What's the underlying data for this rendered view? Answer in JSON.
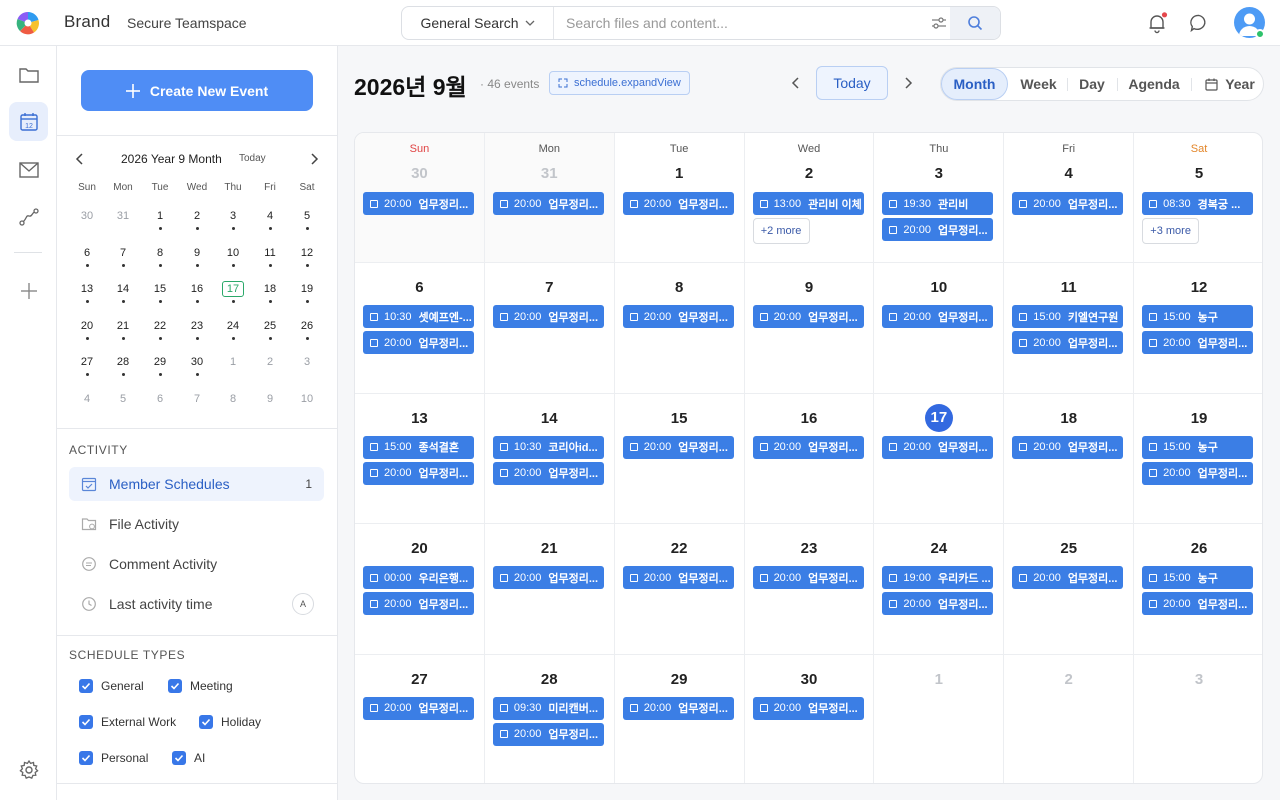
{
  "app": {
    "brand": "Brand",
    "team": "Secure Teamspace"
  },
  "search": {
    "scope": "General Search",
    "placeholder": "Search files and content..."
  },
  "sidebar": {
    "create_label": "Create New Event",
    "mini_cal": {
      "title": "2026 Year 9 Month",
      "today_label": "Today",
      "dow": [
        "Sun",
        "Mon",
        "Tue",
        "Wed",
        "Thu",
        "Fri",
        "Sat"
      ],
      "weeks": [
        [
          "30",
          "31",
          "1",
          "2",
          "3",
          "4",
          "5"
        ],
        [
          "6",
          "7",
          "8",
          "9",
          "10",
          "11",
          "12"
        ],
        [
          "13",
          "14",
          "15",
          "16",
          "17",
          "18",
          "19"
        ],
        [
          "20",
          "21",
          "22",
          "23",
          "24",
          "25",
          "26"
        ],
        [
          "27",
          "28",
          "29",
          "30",
          "1",
          "2",
          "3"
        ],
        [
          "4",
          "5",
          "6",
          "7",
          "8",
          "9",
          "10"
        ]
      ]
    },
    "activity_title": "ACTIVITY",
    "activity": [
      {
        "label": "Member Schedules",
        "count": "1"
      },
      {
        "label": "File Activity"
      },
      {
        "label": "Comment Activity"
      },
      {
        "label": "Last activity time",
        "badge": "A"
      }
    ],
    "types_title": "SCHEDULE TYPES",
    "types": [
      "General",
      "Meeting",
      "External Work",
      "Holiday",
      "Personal",
      "AI"
    ]
  },
  "header": {
    "title": "2026년 9월",
    "event_count": "46 events",
    "expand_label": "schedule.expandView",
    "today_label": "Today",
    "views": [
      "Month",
      "Week",
      "Day",
      "Agenda",
      "Year"
    ],
    "active_view": "Month"
  },
  "calendar": {
    "dow": [
      "Sun",
      "Mon",
      "Tue",
      "Wed",
      "Thu",
      "Fri",
      "Sat"
    ],
    "today": "17",
    "weeks": [
      [
        {
          "day": "30",
          "other": true,
          "events": [
            [
              "20:00",
              "업무정리..."
            ]
          ]
        },
        {
          "day": "31",
          "other": true,
          "events": [
            [
              "20:00",
              "업무정리..."
            ]
          ]
        },
        {
          "day": "1",
          "events": [
            [
              "20:00",
              "업무정리..."
            ]
          ]
        },
        {
          "day": "2",
          "events": [
            [
              "13:00",
              "관리비 이체"
            ]
          ],
          "more": "+2 more"
        },
        {
          "day": "3",
          "events": [
            [
              "19:30",
              "관리비"
            ],
            [
              "20:00",
              "업무정리..."
            ]
          ]
        },
        {
          "day": "4",
          "events": [
            [
              "20:00",
              "업무정리..."
            ]
          ]
        },
        {
          "day": "5",
          "events": [
            [
              "08:30",
              "경복궁 ..."
            ]
          ],
          "more": "+3 more"
        }
      ],
      [
        {
          "day": "6",
          "events": [
            [
              "10:30",
              "셋예프엔-..."
            ],
            [
              "20:00",
              "업무정리..."
            ]
          ]
        },
        {
          "day": "7",
          "events": [
            [
              "20:00",
              "업무정리..."
            ]
          ]
        },
        {
          "day": "8",
          "events": [
            [
              "20:00",
              "업무정리..."
            ]
          ]
        },
        {
          "day": "9",
          "events": [
            [
              "20:00",
              "업무정리..."
            ]
          ]
        },
        {
          "day": "10",
          "events": [
            [
              "20:00",
              "업무정리..."
            ]
          ]
        },
        {
          "day": "11",
          "events": [
            [
              "15:00",
              "키엘연구원"
            ],
            [
              "20:00",
              "업무정리..."
            ]
          ]
        },
        {
          "day": "12",
          "events": [
            [
              "15:00",
              "농구"
            ],
            [
              "20:00",
              "업무정리..."
            ]
          ]
        }
      ],
      [
        {
          "day": "13",
          "events": [
            [
              "15:00",
              "종석결혼"
            ],
            [
              "20:00",
              "업무정리..."
            ]
          ]
        },
        {
          "day": "14",
          "events": [
            [
              "10:30",
              "코리아id..."
            ],
            [
              "20:00",
              "업무정리..."
            ]
          ]
        },
        {
          "day": "15",
          "events": [
            [
              "20:00",
              "업무정리..."
            ]
          ]
        },
        {
          "day": "16",
          "events": [
            [
              "20:00",
              "업무정리..."
            ]
          ]
        },
        {
          "day": "17",
          "events": [
            [
              "20:00",
              "업무정리..."
            ]
          ]
        },
        {
          "day": "18",
          "events": [
            [
              "20:00",
              "업무정리..."
            ]
          ]
        },
        {
          "day": "19",
          "events": [
            [
              "15:00",
              "농구"
            ],
            [
              "20:00",
              "업무정리..."
            ]
          ]
        }
      ],
      [
        {
          "day": "20",
          "events": [
            [
              "00:00",
              "우리은행..."
            ],
            [
              "20:00",
              "업무정리..."
            ]
          ]
        },
        {
          "day": "21",
          "events": [
            [
              "20:00",
              "업무정리..."
            ]
          ]
        },
        {
          "day": "22",
          "events": [
            [
              "20:00",
              "업무정리..."
            ]
          ]
        },
        {
          "day": "23",
          "events": [
            [
              "20:00",
              "업무정리..."
            ]
          ]
        },
        {
          "day": "24",
          "events": [
            [
              "19:00",
              "우리카드 ..."
            ],
            [
              "20:00",
              "업무정리..."
            ]
          ]
        },
        {
          "day": "25",
          "events": [
            [
              "20:00",
              "업무정리..."
            ]
          ]
        },
        {
          "day": "26",
          "events": [
            [
              "15:00",
              "농구"
            ],
            [
              "20:00",
              "업무정리..."
            ]
          ]
        }
      ],
      [
        {
          "day": "27",
          "events": [
            [
              "20:00",
              "업무정리..."
            ]
          ]
        },
        {
          "day": "28",
          "events": [
            [
              "09:30",
              "미리캔버..."
            ],
            [
              "20:00",
              "업무정리..."
            ]
          ]
        },
        {
          "day": "29",
          "events": [
            [
              "20:00",
              "업무정리..."
            ]
          ]
        },
        {
          "day": "30",
          "events": [
            [
              "20:00",
              "업무정리..."
            ]
          ]
        },
        {
          "day": "1",
          "other": true,
          "events": []
        },
        {
          "day": "2",
          "other": true,
          "events": []
        },
        {
          "day": "3",
          "other": true,
          "events": []
        }
      ]
    ]
  }
}
